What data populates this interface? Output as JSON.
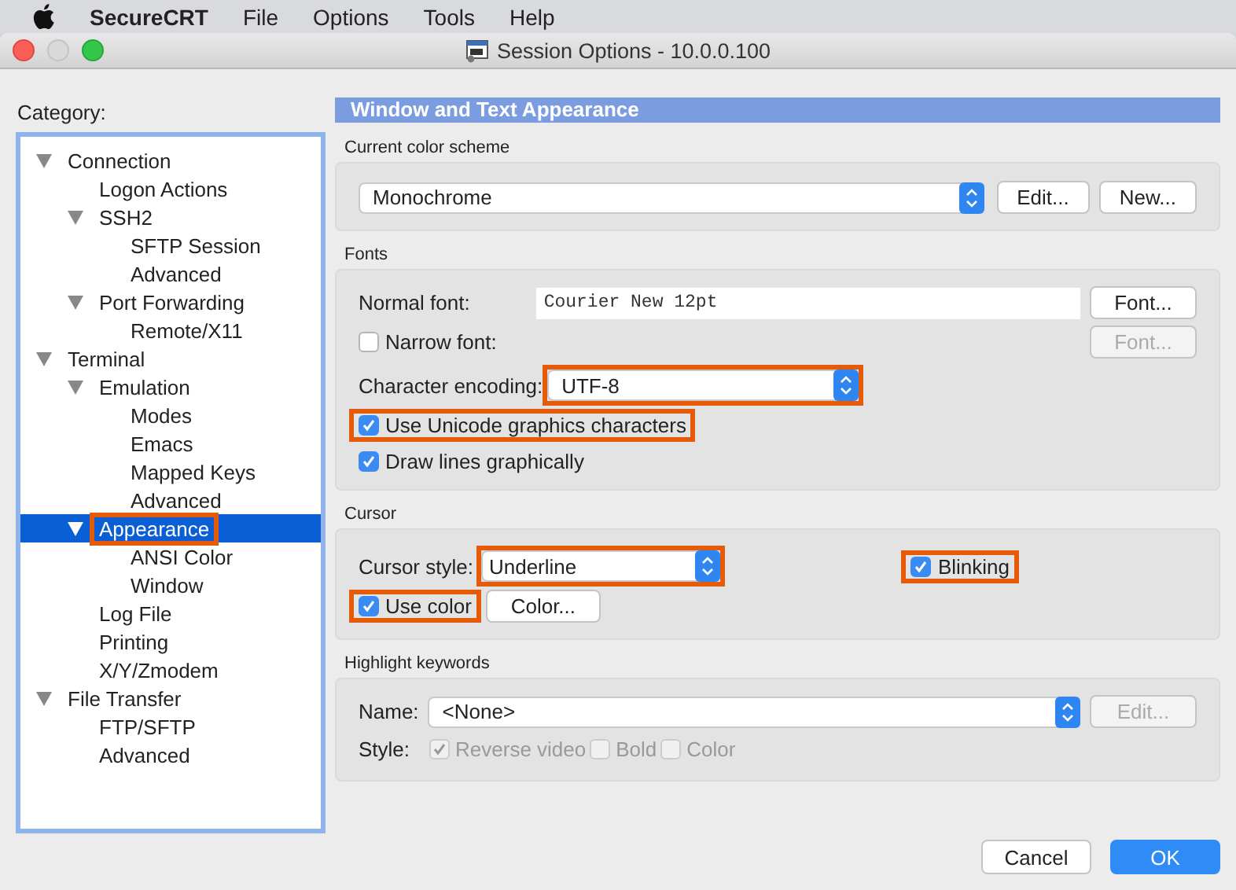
{
  "menu_bar": {
    "items": [
      {
        "label": "SecureCRT",
        "kind": "app"
      },
      {
        "label": "File",
        "kind": "menu"
      },
      {
        "label": "Options",
        "kind": "menu"
      },
      {
        "label": "Tools",
        "kind": "menu"
      },
      {
        "label": "Help",
        "kind": "menu"
      }
    ]
  },
  "window": {
    "title": "Session Options - 10.0.0.100"
  },
  "category": {
    "label": "Category:",
    "tree": [
      {
        "label": "Connection",
        "expanded": true,
        "selected": false,
        "highlighted": false,
        "children": [
          {
            "label": "Logon Actions",
            "selected": false,
            "highlighted": false
          },
          {
            "label": "SSH2",
            "expanded": true,
            "selected": false,
            "highlighted": false,
            "children": [
              {
                "label": "SFTP Session",
                "selected": false,
                "highlighted": false
              },
              {
                "label": "Advanced",
                "selected": false,
                "highlighted": false
              }
            ]
          },
          {
            "label": "Port Forwarding",
            "expanded": true,
            "selected": false,
            "highlighted": false,
            "children": [
              {
                "label": "Remote/X11",
                "selected": false,
                "highlighted": false
              }
            ]
          }
        ]
      },
      {
        "label": "Terminal",
        "expanded": true,
        "selected": false,
        "highlighted": false,
        "children": [
          {
            "label": "Emulation",
            "expanded": true,
            "selected": false,
            "highlighted": false,
            "children": [
              {
                "label": "Modes",
                "selected": false,
                "highlighted": false
              },
              {
                "label": "Emacs",
                "selected": false,
                "highlighted": false
              },
              {
                "label": "Mapped Keys",
                "selected": false,
                "highlighted": false
              },
              {
                "label": "Advanced",
                "selected": false,
                "highlighted": false
              }
            ]
          },
          {
            "label": "Appearance",
            "expanded": true,
            "selected": true,
            "highlighted": true,
            "children": [
              {
                "label": "ANSI Color",
                "selected": false,
                "highlighted": false
              },
              {
                "label": "Window",
                "selected": false,
                "highlighted": false
              }
            ]
          },
          {
            "label": "Log File",
            "selected": false,
            "highlighted": false
          },
          {
            "label": "Printing",
            "selected": false,
            "highlighted": false
          },
          {
            "label": "X/Y/Zmodem",
            "selected": false,
            "highlighted": false
          }
        ]
      },
      {
        "label": "File Transfer",
        "expanded": true,
        "selected": false,
        "highlighted": false,
        "children": [
          {
            "label": "FTP/SFTP",
            "selected": false,
            "highlighted": false
          },
          {
            "label": "Advanced",
            "selected": false,
            "highlighted": false
          }
        ]
      }
    ]
  },
  "panel": {
    "heading": "Window and Text Appearance",
    "color_scheme": {
      "title": "Current color scheme",
      "select": {
        "value": "Monochrome"
      },
      "buttons": [
        {
          "label": "Edit...",
          "disabled": false
        },
        {
          "label": "New...",
          "disabled": false
        }
      ]
    },
    "fonts": {
      "title": "Fonts",
      "normal_font": {
        "label": "Normal font:",
        "value": "Courier New 12pt",
        "button": {
          "label": "Font...",
          "disabled": false
        }
      },
      "narrow_font": {
        "label": "Narrow font:",
        "checked": false,
        "button": {
          "label": "Font...",
          "disabled": true
        }
      },
      "encoding": {
        "label": "Character encoding:",
        "value": "UTF-8",
        "highlighted": true
      },
      "options": [
        {
          "label": "Use Unicode graphics characters",
          "checked": true,
          "highlighted": true
        },
        {
          "label": "Draw lines graphically",
          "checked": true,
          "highlighted": false
        }
      ]
    },
    "cursor": {
      "title": "Cursor",
      "style": {
        "label": "Cursor style:",
        "value": "Underline",
        "highlighted": true
      },
      "blinking": {
        "label": "Blinking",
        "checked": true,
        "highlighted": true
      },
      "use_color": {
        "label": "Use color",
        "checked": true,
        "highlighted": true
      },
      "color_button": {
        "label": "Color...",
        "disabled": false
      }
    },
    "highlight": {
      "title": "Highlight keywords",
      "name": {
        "label": "Name:",
        "value": "<None>",
        "button": {
          "label": "Edit...",
          "disabled": true
        }
      },
      "style": {
        "label": "Style:",
        "options": [
          {
            "label": "Reverse video",
            "checked": true,
            "disabled": true
          },
          {
            "label": "Bold",
            "checked": false,
            "disabled": true
          },
          {
            "label": "Color",
            "checked": false,
            "disabled": true
          }
        ]
      }
    }
  },
  "footer": {
    "buttons": [
      {
        "label": "Cancel",
        "default": false
      },
      {
        "label": "OK",
        "default": true
      }
    ]
  }
}
